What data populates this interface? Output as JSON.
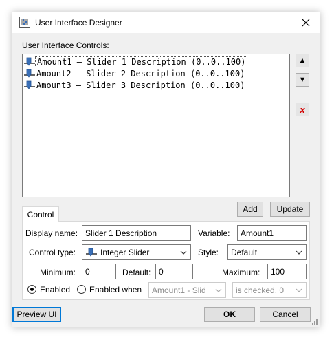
{
  "window": {
    "title": "User Interface Designer"
  },
  "controls_label": "User Interface Controls:",
  "controls_list": [
    {
      "text": "Amount1 — Slider 1 Description (0..0..100)"
    },
    {
      "text": "Amount2 — Slider 2 Description (0..0..100)"
    },
    {
      "text": "Amount3 — Slider 3 Description (0..0..100)"
    }
  ],
  "side_buttons": {
    "up": "▲",
    "down": "▼",
    "delete": "x"
  },
  "add_label": "Add",
  "update_label": "Update",
  "tab_label": "Control",
  "form": {
    "display_name_label": "Display name:",
    "display_name_value": "Slider 1 Description",
    "variable_label": "Variable:",
    "variable_value": "Amount1",
    "control_type_label": "Control type:",
    "control_type_value": "Integer Slider",
    "style_label": "Style:",
    "style_value": "Default",
    "minimum_label": "Minimum:",
    "minimum_value": "0",
    "default_label": "Default:",
    "default_value": "0",
    "maximum_label": "Maximum:",
    "maximum_value": "100",
    "enabled_label": "Enabled",
    "enabled_when_label": "Enabled when",
    "enabled_when_control": "Amount1 - Slid",
    "enabled_when_condition": "is checked, 0"
  },
  "footer": {
    "preview_label": "Preview UI",
    "ok_label": "OK",
    "cancel_label": "Cancel"
  },
  "colors": {
    "accent": "#0078d7",
    "delete_red": "#d40000",
    "window_bg": "#f0f0f0",
    "slider_icon": "#3a6fb7"
  }
}
